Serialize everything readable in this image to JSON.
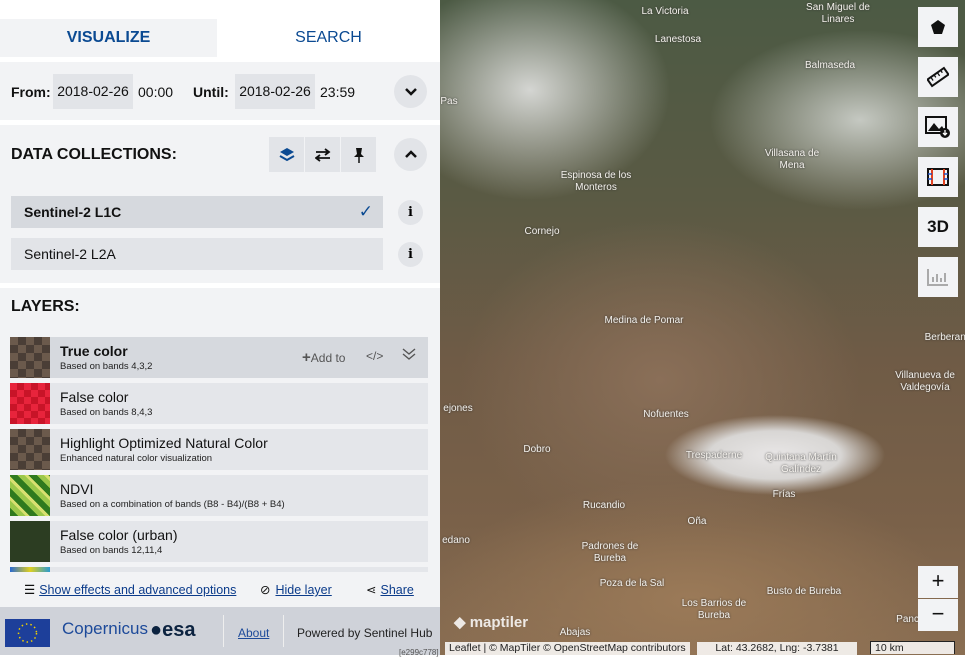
{
  "tabs": {
    "visualize": "VISUALIZE",
    "search": "SEARCH"
  },
  "time": {
    "from_label": "From:",
    "from_date": "2018-02-26",
    "from_time": "00:00",
    "until_label": "Until:",
    "until_date": "2018-02-26",
    "until_time": "23:59"
  },
  "collections": {
    "title": "DATA COLLECTIONS:",
    "items": [
      {
        "name": "Sentinel-2 L1C",
        "selected": true
      },
      {
        "name": "Sentinel-2 L2A",
        "selected": false
      }
    ],
    "info": "i"
  },
  "layers": {
    "title": "LAYERS:",
    "add_to": "Add to",
    "code": "</>",
    "items": [
      {
        "name": "True color",
        "desc": "Based on bands 4,3,2"
      },
      {
        "name": "False color",
        "desc": "Based on bands 8,4,3"
      },
      {
        "name": "Highlight Optimized Natural Color",
        "desc": "Enhanced natural color visualization"
      },
      {
        "name": "NDVI",
        "desc": "Based on a combination of bands (B8 - B4)/(B8 + B4)"
      },
      {
        "name": "False color (urban)",
        "desc": "Based on bands 12,11,4"
      }
    ]
  },
  "options": {
    "effects": "Show effects and advanced options",
    "hide": "Hide layer",
    "share": "Share"
  },
  "footer": {
    "about": "About",
    "powered": "Powered by Sentinel Hub",
    "version": "[e299c778]",
    "logos": [
      "copernicus",
      "esa"
    ]
  },
  "map": {
    "places": [
      "La Victoria",
      "San Miguel de Linares",
      "Lanestosa",
      "Balmaseda",
      "Pas",
      "Villasana de Mena",
      "Espinosa de los Monteros",
      "Cornejo",
      "Medina de Pomar",
      "Berberana",
      "Villanueva de Valdegovía",
      "ejones",
      "Nofuentes",
      "Dobro",
      "Trespaderne",
      "Quintana Martín Galíndez",
      "Frías",
      "Rucandio",
      "Oña",
      "edano",
      "Padrones de Bureba",
      "Poza de la Sal",
      "Los Barrios de Bureba",
      "Busto de Bureba",
      "Pancor",
      "Abajas"
    ],
    "tools": [
      "pentagon-icon",
      "ruler-icon",
      "image-download-icon",
      "film-icon",
      "3D",
      "chart-icon"
    ],
    "zoom_in": "+",
    "zoom_out": "−",
    "maptiler": "maptiler",
    "attribution": "Leaflet | © MapTiler © OpenStreetMap contributors",
    "coords": "Lat: 43.2682, Lng: -3.7381",
    "scale": "10 km"
  }
}
